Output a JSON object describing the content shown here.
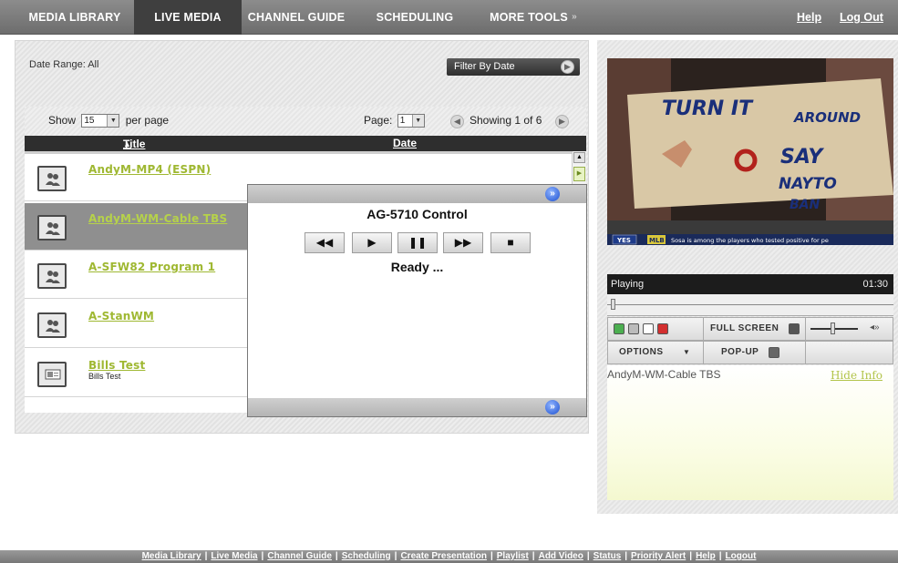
{
  "nav": {
    "tabs": [
      "MEDIA LIBRARY",
      "LIVE MEDIA",
      "CHANNEL GUIDE",
      "SCHEDULING",
      "MORE TOOLS"
    ],
    "active_tab": "LIVE MEDIA",
    "more_tools_caret": "»",
    "help": "Help",
    "logout": "Log Out"
  },
  "filters": {
    "date_range_label": "Date Range: All",
    "filter_button": "Filter By Date"
  },
  "list": {
    "show_label": "Show",
    "per_page_value": "15",
    "per_page_suffix": "per page",
    "page_label": "Page:",
    "page_value": "1",
    "showing": "Showing 1 of 6",
    "columns": {
      "title": "Title",
      "title_sort": "▲",
      "date": "Date"
    },
    "items": [
      {
        "title": "AndyM-MP4 (ESPN)",
        "subtitle": "",
        "icon": "people-icon",
        "selected": false
      },
      {
        "title": "AndyM-WM-Cable TBS",
        "subtitle": "",
        "icon": "people-icon",
        "selected": true
      },
      {
        "title": "A-SFW82 Program 1",
        "subtitle": "",
        "icon": "people-icon",
        "selected": false
      },
      {
        "title": "A-StanWM",
        "subtitle": "",
        "icon": "people-icon",
        "selected": false
      },
      {
        "title": "Bills Test",
        "subtitle": "Bills Test",
        "icon": "presentation-icon",
        "selected": false
      }
    ]
  },
  "control": {
    "title": "AG-5710 Control",
    "buttons": [
      "◀◀",
      "▶",
      "❚❚",
      "▶▶",
      "■"
    ],
    "status": "Ready ..."
  },
  "player": {
    "video_text": {
      "sign_line1": "TURN IT",
      "sign_line1b": "AROUND",
      "sign_line2": "SAY",
      "sign_line3": "NAYTO",
      "sign_line4": "BAN",
      "ticker_yes": "YES",
      "ticker_mlb": "MLB",
      "ticker": "Sosa is among the players who tested positive for pe"
    },
    "state": "Playing",
    "time": "01:30",
    "full_screen": "FULL SCREEN",
    "options": "OPTIONS",
    "popup": "POP-UP",
    "info_title": "AndyM-WM-Cable TBS",
    "hide_info": "Hide Info",
    "colors": {
      "play": "#4caf50",
      "record": "#d32f2f"
    }
  },
  "footer": {
    "links": [
      "Media Library",
      "Live Media",
      "Channel Guide",
      "Scheduling",
      "Create Presentation",
      "Playlist",
      "Add Video",
      "Status",
      "Priority Alert",
      "Help",
      "Logout"
    ],
    "separator": "|"
  }
}
